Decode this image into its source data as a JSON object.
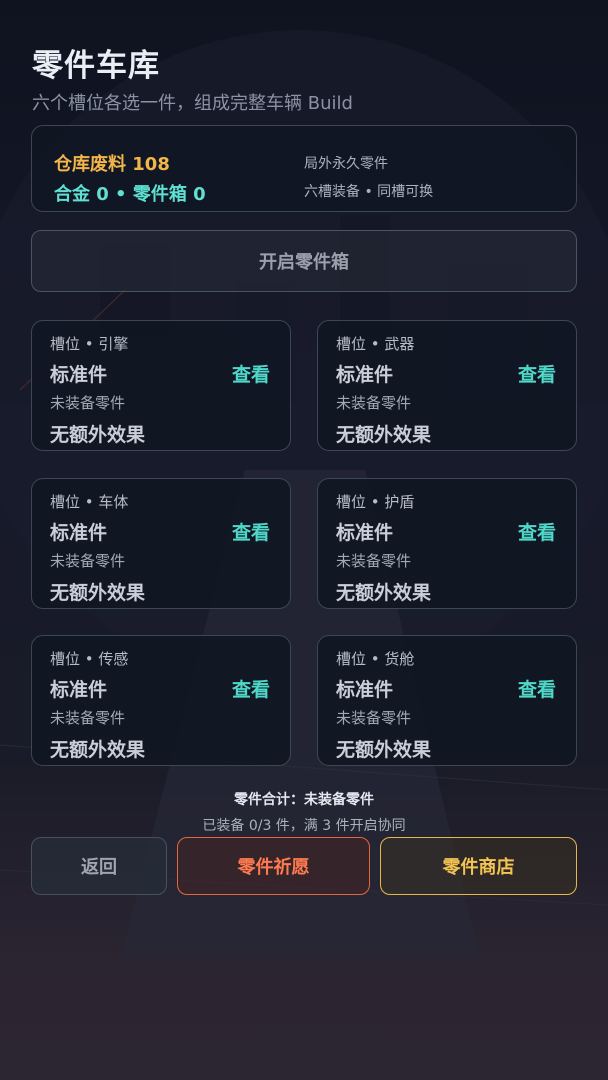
{
  "header": {
    "title": "零件车库",
    "subtitle": "六个槽位各选一件，组成完整车辆 Build"
  },
  "resources": {
    "scrap": "仓库废料 108",
    "alloy": "合金 0 • 零件箱 0",
    "note_permanent": "局外永久零件",
    "note_slots": "六槽装备 • 同槽可换"
  },
  "open_box_label": "开启零件箱",
  "slots": [
    {
      "label": "槽位 • 引擎",
      "tier": "标准件",
      "action": "查看",
      "status": "未装备零件",
      "effect": "无额外效果"
    },
    {
      "label": "槽位 • 武器",
      "tier": "标准件",
      "action": "查看",
      "status": "未装备零件",
      "effect": "无额外效果"
    },
    {
      "label": "槽位 • 车体",
      "tier": "标准件",
      "action": "查看",
      "status": "未装备零件",
      "effect": "无额外效果"
    },
    {
      "label": "槽位 • 护盾",
      "tier": "标准件",
      "action": "查看",
      "status": "未装备零件",
      "effect": "无额外效果"
    },
    {
      "label": "槽位 • 传感",
      "tier": "标准件",
      "action": "查看",
      "status": "未装备零件",
      "effect": "无额外效果"
    },
    {
      "label": "槽位 • 货舱",
      "tier": "标准件",
      "action": "查看",
      "status": "未装备零件",
      "effect": "无额外效果"
    }
  ],
  "summary": {
    "total": "零件合计：未装备零件",
    "synergy": "已装备 0/3 件，满 3 件开启协同"
  },
  "buttons": {
    "back": "返回",
    "wish": "零件祈愿",
    "shop": "零件商店"
  },
  "colors": {
    "scrap": "#f2b54a",
    "alloy": "#5fe0d3",
    "view": "#4fd8c9",
    "wish": "#ff7a4f",
    "shop": "#f4c453"
  }
}
